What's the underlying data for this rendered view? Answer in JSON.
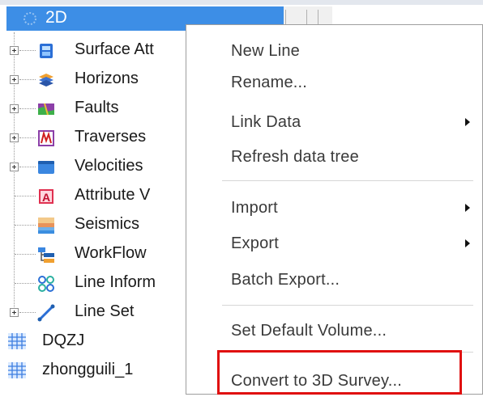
{
  "tree": {
    "selected_node": {
      "label": "2D",
      "icon": "survey-icon"
    },
    "children": [
      {
        "label": "Surface Att",
        "icon": "surface-attribute-icon",
        "expandable": true
      },
      {
        "label": "Horizons",
        "icon": "horizons-icon",
        "expandable": true
      },
      {
        "label": "Faults",
        "icon": "faults-icon",
        "expandable": true
      },
      {
        "label": "Traverses",
        "icon": "traverses-icon",
        "expandable": true
      },
      {
        "label": "Velocities",
        "icon": "velocities-icon",
        "expandable": true
      },
      {
        "label": "Attribute V",
        "icon": "attribute-volume-icon",
        "expandable": false
      },
      {
        "label": "Seismics",
        "icon": "seismics-icon",
        "expandable": false
      },
      {
        "label": "WorkFlow",
        "icon": "workflow-icon",
        "expandable": false
      },
      {
        "label": "Line Inform",
        "icon": "line-information-icon",
        "expandable": false
      },
      {
        "label": "Line Set",
        "icon": "line-set-icon",
        "expandable": true
      }
    ],
    "roots": [
      {
        "label": "DQZJ",
        "icon": "survey-icon"
      },
      {
        "label": "zhongguili_1",
        "icon": "survey-icon"
      }
    ]
  },
  "context_menu": {
    "groups": [
      [
        {
          "label": "New Line",
          "submenu": false
        },
        {
          "label": "Rename...",
          "submenu": false
        },
        {
          "label": "Link Data",
          "submenu": true
        },
        {
          "label": "Refresh data tree",
          "submenu": false
        }
      ],
      [
        {
          "label": "Import",
          "submenu": true
        },
        {
          "label": "Export",
          "submenu": true
        },
        {
          "label": "Batch Export...",
          "submenu": false
        }
      ],
      [
        {
          "label": "Set Default Volume...",
          "submenu": false
        }
      ],
      [
        {
          "label": "Convert to 3D Survey...",
          "submenu": false,
          "highlighted": true
        }
      ]
    ]
  },
  "colors": {
    "selection": "#3d8ee6",
    "highlight_box": "#e01010",
    "menu_text": "#3a3a3a"
  }
}
